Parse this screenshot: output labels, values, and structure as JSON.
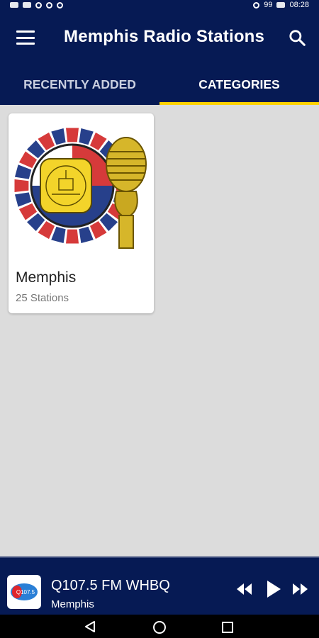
{
  "status_bar": {
    "time": "08:28",
    "battery": "99"
  },
  "app_bar": {
    "title": "Memphis Radio Stations"
  },
  "tabs": [
    {
      "label": "RECENTLY ADDED",
      "active": false
    },
    {
      "label": "CATEGORIES",
      "active": true
    }
  ],
  "categories": [
    {
      "name": "Memphis",
      "count": "25 Stations"
    }
  ],
  "player": {
    "station": "Q107.5 FM WHBQ",
    "city": "Memphis",
    "logo_text": "Q107.5"
  },
  "colors": {
    "primary": "#061a54",
    "accent": "#ffd200",
    "background": "#dcdcdc"
  }
}
